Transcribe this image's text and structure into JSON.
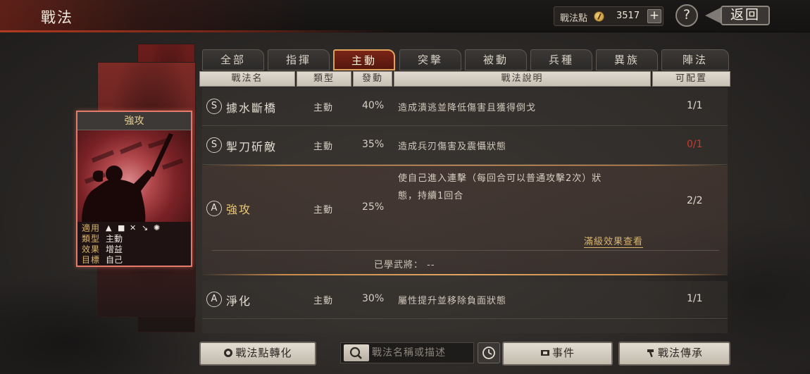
{
  "header": {
    "title": "戰法",
    "points_label": "戰法點",
    "points_value": "3517",
    "plus_label": "+",
    "help_label": "?",
    "back_label": "返回"
  },
  "card": {
    "title": "強攻",
    "applies_key": "適用",
    "type_key": "類型",
    "type_val": "主動",
    "effect_key": "效果",
    "effect_val": "增益",
    "target_key": "目標",
    "target_val": "自己"
  },
  "tabs": [
    "全部",
    "指揮",
    "主動",
    "突擊",
    "被動",
    "兵種",
    "異族",
    "陣法"
  ],
  "columns": [
    "戰法名",
    "類型",
    "發動",
    "戰法說明",
    "可配置"
  ],
  "rows": [
    {
      "grade": "S",
      "name": "據水斷橋",
      "type": "主動",
      "rate": "40%",
      "desc": "造成潰逃並降低傷害且獲得倒戈",
      "count": "1/1"
    },
    {
      "grade": "S",
      "name": "掣刀斫敵",
      "type": "主動",
      "rate": "35%",
      "desc": "造成兵刃傷害及震懾狀態",
      "count": "0/1"
    },
    {
      "grade": "A",
      "name": "強攻",
      "type": "主動",
      "rate": "25%",
      "desc_line1": "使自己進入連擊（每回合可以普通攻擊2次）狀",
      "desc_line2": "態，持續1回合",
      "count": "2/2",
      "max_link": "滿級效果查看",
      "learned": "已學武將： --"
    },
    {
      "grade": "A",
      "name": "淨化",
      "type": "主動",
      "rate": "30%",
      "desc": "屬性提升並移除負面狀態",
      "count": "1/1"
    }
  ],
  "footer": {
    "convert_label": "戰法點轉化",
    "search_placeholder": "戰法名稱或描述",
    "event_label": "事件",
    "inherit_label": "戰法傳承"
  },
  "colors": {
    "active_tab": "#7a2416",
    "accent_gold": "#e0a25a",
    "warning_red": "#c63b2e"
  }
}
